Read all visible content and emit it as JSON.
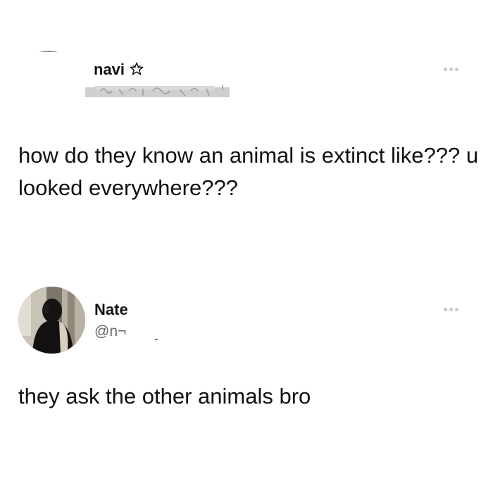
{
  "posts": [
    {
      "display_name": "navi",
      "name_icon": "outline-star-icon",
      "handle_state": "redacted",
      "more_icon": "more-options-icon",
      "text": "how do they know an animal is extinct like??? u looked everywhere???"
    },
    {
      "display_name": "Nate",
      "handle": "@n¬",
      "more_icon": "more-options-icon",
      "text": "they ask the other animals bro"
    }
  ],
  "colors": {
    "background": "#ffffff",
    "text": "#111111",
    "handle": "#666666",
    "more_dots": "#c9c9c9",
    "redaction": "#c3c3c3"
  }
}
